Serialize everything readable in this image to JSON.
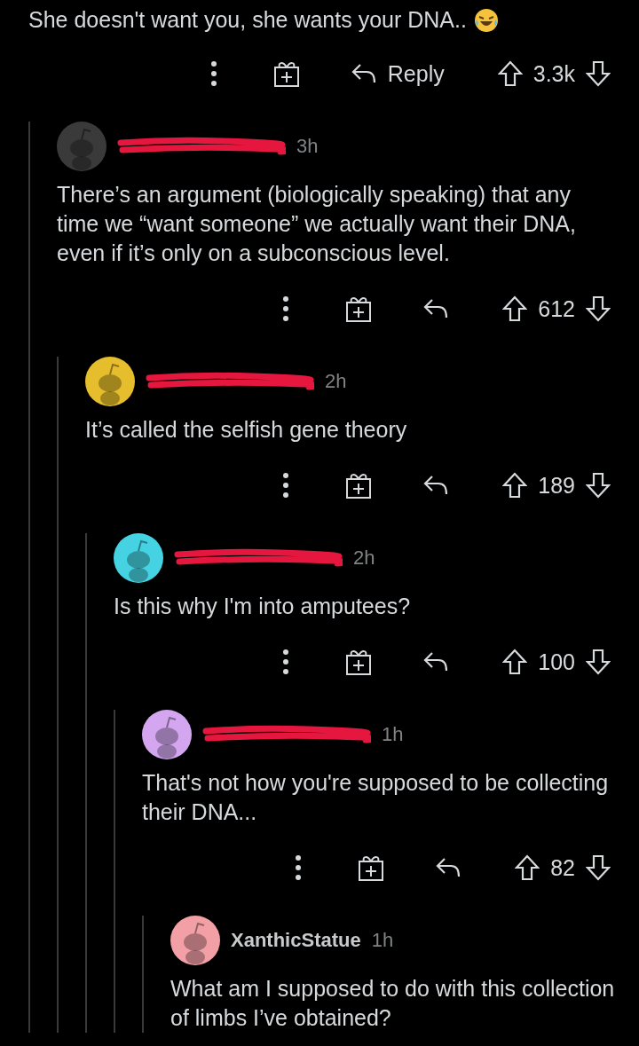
{
  "thread": {
    "text": "She doesn't want you, she wants your DNA..",
    "emoji": {
      "kind": "laughing"
    },
    "reply_label": "Reply",
    "score": "3.3k",
    "children": [
      {
        "color": "#3a3a3a",
        "redacted": true,
        "time": "3h",
        "text": "There’s an argument (biologically speaking) that any time we “want someone” we actually want their DNA, even if it’s only on a subconscious level.",
        "score": "612",
        "children": [
          {
            "color": "#e6bd2c",
            "redacted": true,
            "time": "2h",
            "text": "It’s called the selfish gene theory",
            "score": "189",
            "children": [
              {
                "color": "#45d3e3",
                "redacted": true,
                "time": "2h",
                "text": "Is this why I'm into amputees?",
                "score": "100",
                "children": [
                  {
                    "color": "#d3a6ef",
                    "redacted": true,
                    "time": "1h",
                    "text": "That's not how you're supposed to be collecting their DNA...",
                    "score": "82",
                    "children": [
                      {
                        "color": "#f2a0a6",
                        "redacted": false,
                        "author": "XanthicStatue",
                        "time": "1h",
                        "text": "What am I supposed to do with this collection of limbs I’ve obtained?"
                      }
                    ]
                  }
                ]
              }
            ]
          }
        ]
      }
    ]
  }
}
